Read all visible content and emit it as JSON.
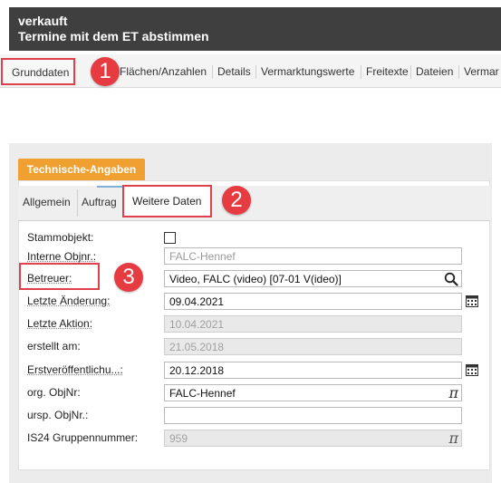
{
  "header": {
    "title": "verkauft",
    "subtitle": "Termine mit dem ET abstimmen"
  },
  "tabs": [
    {
      "label": "Grunddaten"
    },
    {
      "label": "Flächen/Anzahlen"
    },
    {
      "label": "Details"
    },
    {
      "label": "Vermarktungswerte"
    },
    {
      "label": "Freitexte"
    },
    {
      "label": "Dateien"
    },
    {
      "label": "Vermar"
    }
  ],
  "section": {
    "title": "Technische-Angaben"
  },
  "subtabs": [
    {
      "label": "Allgemein"
    },
    {
      "label": "Auftrag"
    },
    {
      "label": "Weitere Daten"
    }
  ],
  "callouts": {
    "one": "1",
    "two": "2",
    "three": "3"
  },
  "fields": {
    "stammobjekt": {
      "label": "Stammobjekt:"
    },
    "interne_objnr": {
      "label": "Interne Objnr.:",
      "value": "FALC-Hennef"
    },
    "betreuer": {
      "label": "Betreuer:",
      "value": "Video, FALC (video) [07-01 V(ideo)]"
    },
    "letzte_aenderung": {
      "label": "Letzte Änderung:",
      "value": "09.04.2021"
    },
    "letzte_aktion": {
      "label": "Letzte Aktion:",
      "value": "10.04.2021"
    },
    "erstellt_am": {
      "label": "erstellt am:",
      "value": "21.05.2018"
    },
    "erstveroeffentlichung": {
      "label": "Erstveröffentlichu...:",
      "value": "20.12.2018"
    },
    "org_objnr": {
      "label": "org. ObjNr:",
      "value": "FALC-Hennef"
    },
    "ursp_objnr": {
      "label": "ursp. ObjNr.:",
      "value": ""
    },
    "is24": {
      "label": "IS24 Gruppennummer:",
      "value": "959"
    }
  },
  "icons": {
    "search": "search-icon",
    "calendar": "calendar-icon",
    "pi": "π"
  },
  "colors": {
    "header_bg": "#3f3f3f",
    "accent_orange": "#f0a030",
    "highlight_red": "#e0404a",
    "callout_red": "#e63c41"
  }
}
